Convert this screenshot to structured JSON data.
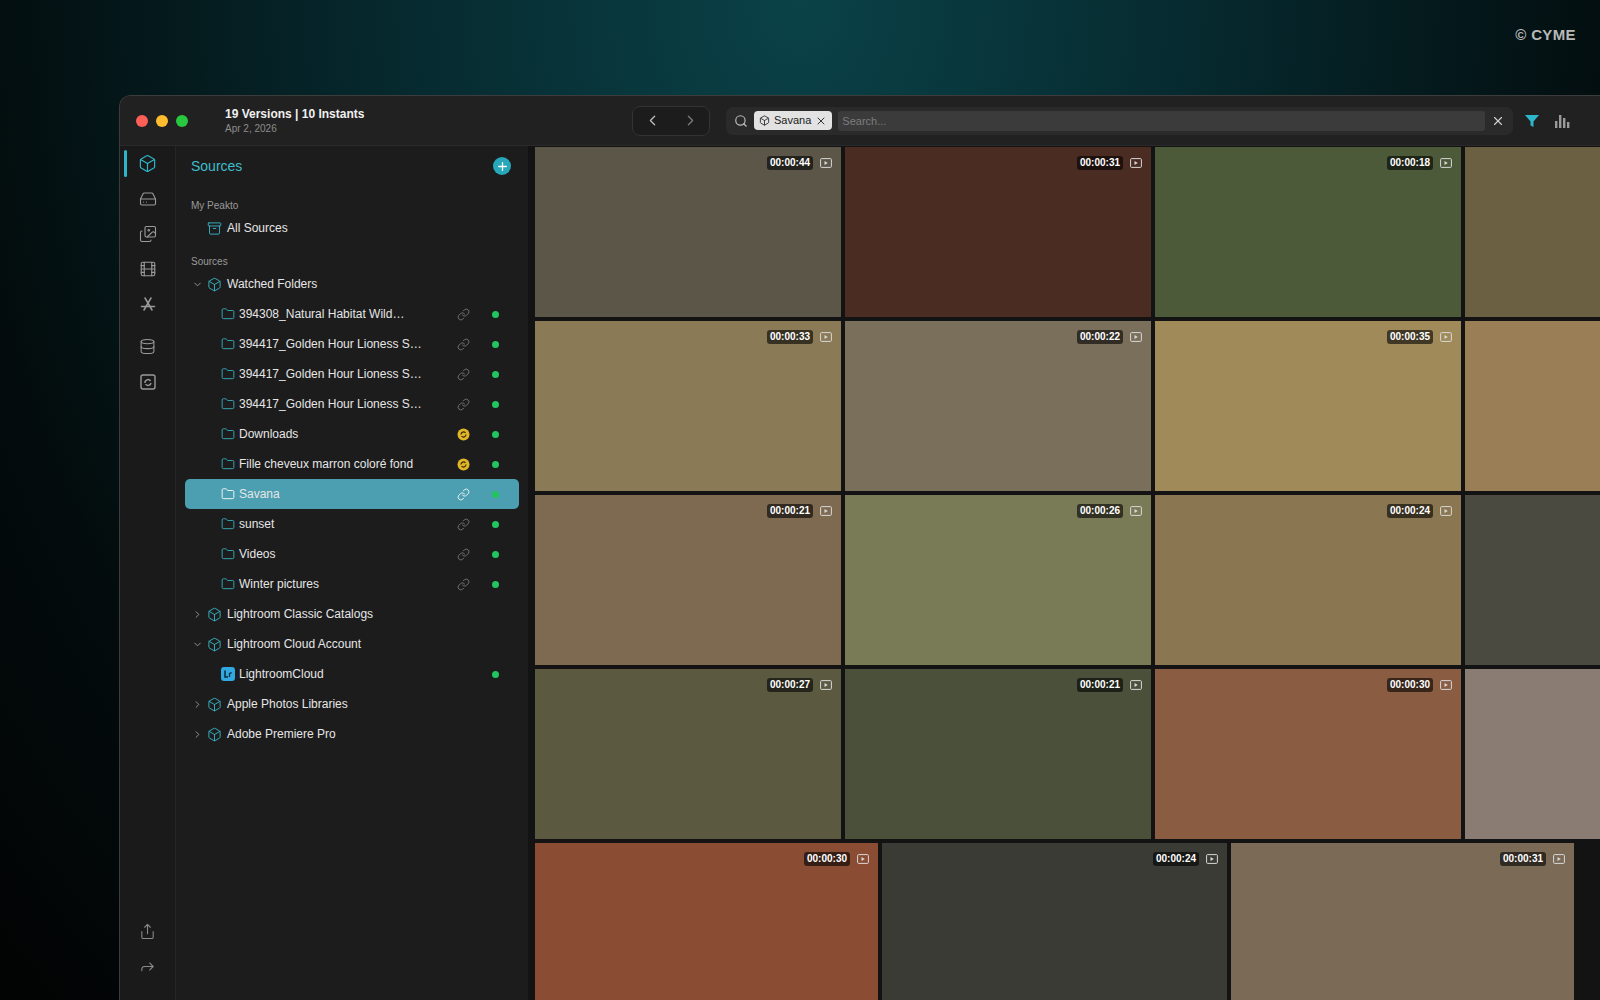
{
  "watermark": "© CYME",
  "window": {
    "title": "19 Versions | 10 Instants",
    "subtitle": "Apr 2, 2026"
  },
  "toolbar": {
    "search": {
      "chip": "Savana",
      "placeholder": "Search..."
    }
  },
  "rail": {
    "main": [
      {
        "selected": true
      },
      {
        "selected": false
      },
      {
        "selected": false
      },
      {
        "selected": false
      },
      {
        "selected": false
      }
    ],
    "extra": [
      {
        "selected": false
      },
      {
        "selected": false
      }
    ],
    "bottom": [
      {
        "selected": false
      },
      {
        "selected": false
      }
    ]
  },
  "sidebar": {
    "header": "Sources",
    "sections": [
      {
        "label": "My Peakto",
        "entries": [
          {
            "name": "All Sources",
            "kind": "all",
            "expanded": false,
            "children": []
          }
        ]
      },
      {
        "label": "Sources",
        "entries": [
          {
            "name": "Watched Folders",
            "kind": "group",
            "expanded": true,
            "children": [
              {
                "name": "394308_Natural Habitat Wild…",
                "kind": "folder",
                "status": "link",
                "online": true,
                "selected": false
              },
              {
                "name": "394417_Golden Hour Lioness S…",
                "kind": "folder",
                "status": "link",
                "online": true,
                "selected": false
              },
              {
                "name": "394417_Golden Hour Lioness S…",
                "kind": "folder",
                "status": "link",
                "online": true,
                "selected": false
              },
              {
                "name": "394417_Golden Hour Lioness S…",
                "kind": "folder",
                "status": "link",
                "online": true,
                "selected": false
              },
              {
                "name": "Downloads",
                "kind": "folder",
                "status": "sync",
                "online": true,
                "selected": false
              },
              {
                "name": "Fille cheveux marron coloré fond",
                "kind": "folder",
                "status": "sync",
                "online": true,
                "selected": false
              },
              {
                "name": "Savana",
                "kind": "folder",
                "status": "link",
                "online": true,
                "selected": true
              },
              {
                "name": "sunset",
                "kind": "folder",
                "status": "link",
                "online": true,
                "selected": false
              },
              {
                "name": "Videos",
                "kind": "folder",
                "status": "link",
                "online": true,
                "selected": false
              },
              {
                "name": "Winter pictures",
                "kind": "folder",
                "status": "link",
                "online": true,
                "selected": false
              }
            ]
          },
          {
            "name": "Lightroom Classic Catalogs",
            "kind": "group",
            "expanded": false,
            "children": []
          },
          {
            "name": "Lightroom Cloud Account",
            "kind": "group",
            "expanded": true,
            "children": [
              {
                "name": "LightroomCloud",
                "kind": "lightroom",
                "status": "none",
                "online": true,
                "selected": false
              }
            ]
          },
          {
            "name": "Apple Photos Libraries",
            "kind": "group",
            "expanded": false,
            "children": []
          },
          {
            "name": "Adobe Premiere Pro",
            "kind": "group",
            "expanded": false,
            "children": []
          }
        ]
      }
    ]
  },
  "grid": {
    "rows": [
      [
        {
          "duration": "00:00:44",
          "color": "#5b5648"
        },
        {
          "duration": "00:00:31",
          "color": "#4a2c22"
        },
        {
          "duration": "00:00:18",
          "color": "#4d5a39"
        },
        {
          "color": "#6b6042"
        }
      ],
      [
        {
          "duration": "00:00:33",
          "color": "#8a7a56"
        },
        {
          "duration": "00:00:22",
          "color": "#7a6f5a"
        },
        {
          "duration": "00:00:35",
          "color": "#a08a5a"
        },
        {
          "color": "#9a7e56"
        }
      ],
      [
        {
          "duration": "00:00:21",
          "color": "#7e6a51"
        },
        {
          "duration": "00:00:26",
          "color": "#797a56"
        },
        {
          "duration": "00:00:24",
          "color": "#8a7651"
        },
        {
          "color": "#4a4a41"
        }
      ],
      [
        {
          "duration": "00:00:27",
          "color": "#5b5a41"
        },
        {
          "duration": "00:00:21",
          "color": "#4a5039"
        },
        {
          "duration": "00:00:30",
          "color": "#8a5c42"
        },
        {
          "color": "#8a7c72"
        }
      ],
      [
        {
          "duration": "00:00:30",
          "color": "#8a4c32"
        },
        {
          "duration": "00:00:24",
          "color": "#3b3b36"
        },
        {
          "duration": "00:00:31",
          "color": "#7a6a56"
        }
      ]
    ]
  }
}
